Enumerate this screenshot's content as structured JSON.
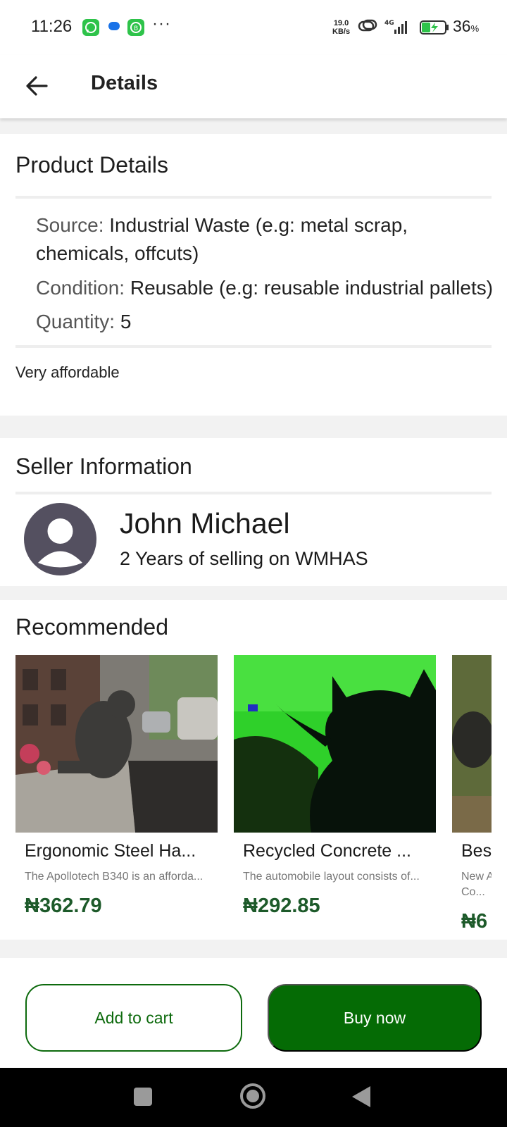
{
  "status_bar": {
    "time": "11:26",
    "more": "···",
    "net_speed_value": "19.0",
    "net_speed_unit": "KB/s",
    "network": "4G",
    "battery_percent": "36",
    "battery_unit": "%",
    "icons": [
      "whatsapp-icon",
      "messages-icon",
      "whatsapp-business-icon",
      "link-icon",
      "signal-icon",
      "battery-charging-icon"
    ]
  },
  "header": {
    "title": "Details",
    "back_icon": "arrow-left-icon"
  },
  "product_details": {
    "title": "Product Details",
    "source_label": "Source:",
    "source_value": "Industrial Waste (e.g: metal scrap, chemicals, offcuts)",
    "condition_label": "Condition:",
    "condition_value": "Reusable (e.g: reusable industrial pallets)",
    "quantity_label": "Quantity:",
    "quantity_value": "5",
    "description": "Very affordable"
  },
  "seller": {
    "title": "Seller Information",
    "name": "John Michael",
    "tenure": "2 Years of selling on WMHAS"
  },
  "recommended": {
    "title": "Recommended",
    "items": [
      {
        "name": "Ergonomic Steel Ha...",
        "description": "The Apollotech B340 is an afforda...",
        "price": "₦362.79"
      },
      {
        "name": "Recycled Concrete ...",
        "description": "The automobile layout consists of...",
        "price": "₦292.85"
      },
      {
        "name": "Besp",
        "description_line1": "New A",
        "description_line2": "Co...",
        "price": "₦6"
      }
    ]
  },
  "actions": {
    "add_to_cart": "Add to cart",
    "buy_now": "Buy now"
  },
  "colors": {
    "primary": "#056b05",
    "price": "#1d5a2a",
    "avatar": "#545060"
  }
}
